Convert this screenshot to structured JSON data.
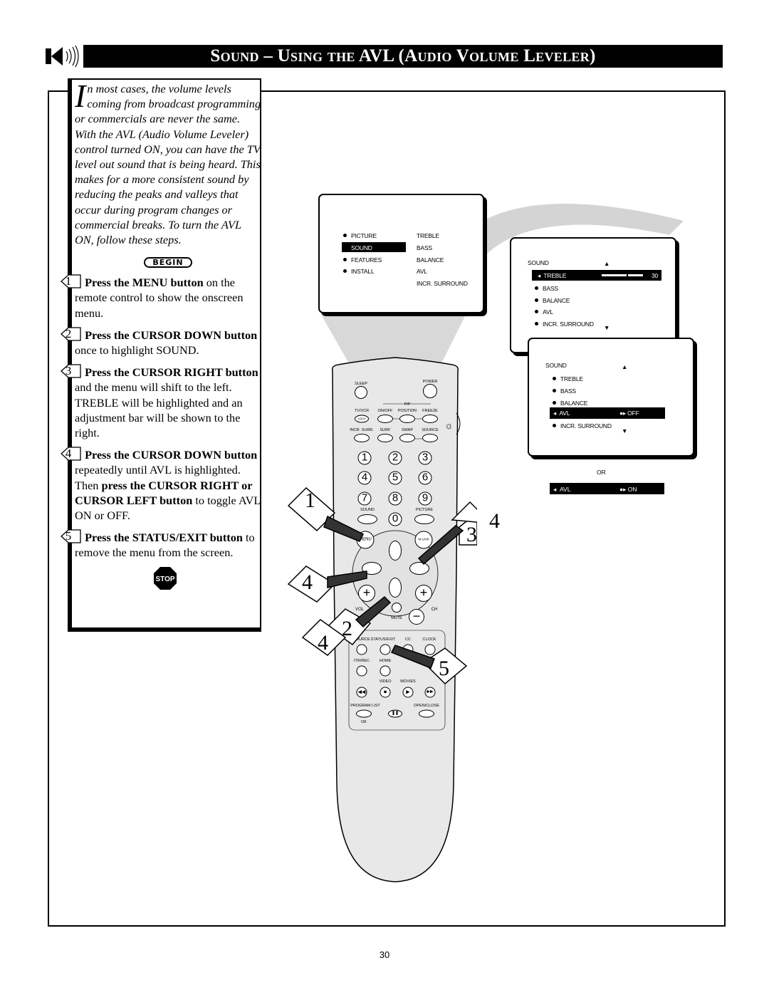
{
  "header": {
    "title": "Sound – Using the AVL (Audio Volume Leveler)",
    "icon": "speaker-icon"
  },
  "intro": {
    "dropcap": "I",
    "text": "n most cases, the volume levels coming from broadcast programming or commercials are never the same.  With the AVL (Audio Volume Leveler) control turned ON, you can have the TV level out sound that is being heard.  This makes for a more consistent sound by reducing the peaks and valleys that occur during program changes or commercial breaks.  To turn the AVL ON, follow these steps."
  },
  "begin_label": "BEGIN",
  "stop_label": "STOP",
  "steps": [
    {
      "num": "1",
      "parts": [
        {
          "text": "Press the MENU button"
        },
        {
          "text": " on the remote control to show the onscreen menu."
        }
      ]
    },
    {
      "num": "2",
      "parts": [
        {
          "text": "Press the CURSOR DOWN button"
        },
        {
          "text": " once to highlight SOUND."
        }
      ]
    },
    {
      "num": "3",
      "parts": [
        {
          "text": "Press the CURSOR RIGHT button"
        },
        {
          "text": " and the menu will shift to the left. TREBLE will be highlighted and an adjustment bar will be shown to the right."
        }
      ]
    },
    {
      "num": "4",
      "parts": [
        {
          "text": "Press the CURSOR DOWN button"
        },
        {
          "text": " repeatedly until AVL is highlighted.  Then "
        },
        {
          "text": "press the CURSOR RIGHT or CURSOR LEFT button"
        },
        {
          "text": " to toggle AVL ON or OFF."
        }
      ]
    },
    {
      "num": "5",
      "parts": [
        {
          "text": "Press the STATUS/EXIT button"
        },
        {
          "text": " to remove the menu from the screen."
        }
      ]
    }
  ],
  "main_menu": {
    "left": [
      "PICTURE",
      "SOUND",
      "FEATURES",
      "INSTALL"
    ],
    "right": [
      "TREBLE",
      "BASS",
      "BALANCE",
      "AVL",
      "INCR. SURROUND"
    ],
    "selected": "SOUND"
  },
  "sound_menu_1": {
    "title": "SOUND",
    "items": [
      "TREBLE",
      "BASS",
      "BALANCE",
      "AVL",
      "INCR. SURROUND"
    ],
    "selected": "TREBLE",
    "treble_value": "30",
    "treble_level": 0.6
  },
  "sound_menu_2": {
    "title": "SOUND",
    "items": [
      "TREBLE",
      "BASS",
      "BALANCE",
      "AVL",
      "INCR. SURROUND"
    ],
    "selected": "AVL",
    "avl_value": "OFF"
  },
  "or_label": "OR",
  "avl_on": {
    "label": "AVL",
    "value": "ON"
  },
  "remote": {
    "sleep": "SLEEP",
    "power": "POWER",
    "pip": "PIP",
    "tvvcr": "TV/VCR",
    "achbtn": "A/CH",
    "onoff": "ON/OFF",
    "position": "POSITION",
    "freeze": "FREEZE",
    "incr_surr": "INCR. SURR.",
    "surf": "SURF",
    "swap": "SWAP",
    "source": "SOURCE",
    "digits": [
      "1",
      "2",
      "3",
      "4",
      "5",
      "6",
      "7",
      "8",
      "9",
      "0"
    ],
    "sound": "SOUND",
    "picture": "PICTURE",
    "menu": "MENU",
    "mlink": "M-LINK",
    "vol": "VOL",
    "ch": "CH",
    "mute": "MUTE",
    "source2": "SOURCE",
    "status_exit": "STATUS/EXIT",
    "cc": "CC",
    "clock": "CLOCK",
    "itr_rec": "ITR/REC",
    "home": "HOME",
    "video": "VIDEO",
    "movies": "MOVIES",
    "program_list": "PROGRAM LIST",
    "open_close": "OPEN/CLOSE",
    "ok": "OK"
  },
  "callouts": [
    "1",
    "4",
    "2",
    "4",
    "3",
    "4",
    "5"
  ],
  "page_number": "30"
}
